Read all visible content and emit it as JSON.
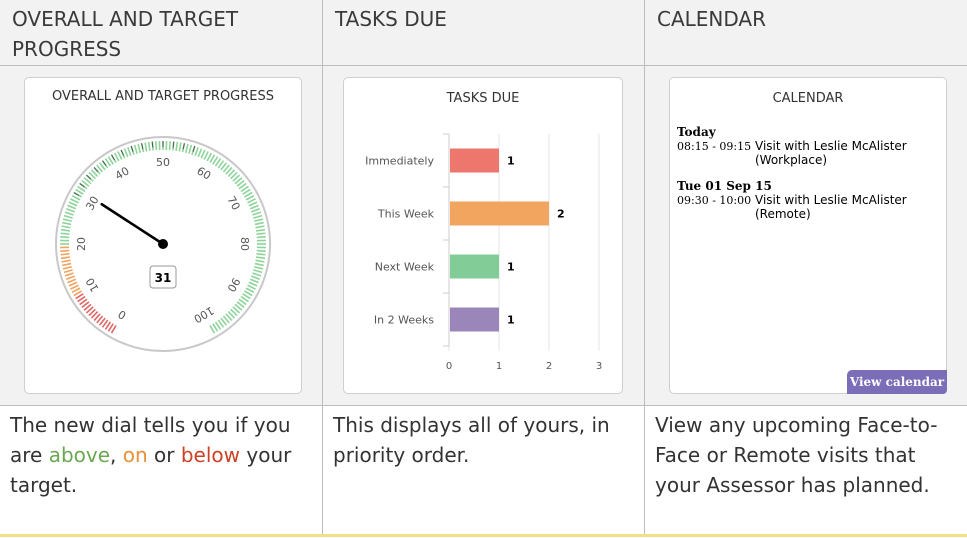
{
  "headers": [
    "OVERALL AND TARGET PROGRESS",
    "TASKS DUE",
    "CALENDAR"
  ],
  "progress_panel": {
    "title": "OVERALL AND TARGET PROGRESS",
    "value": "31",
    "value_num": 31,
    "scale_labels": [
      "0",
      "10",
      "20",
      "30",
      "40",
      "50",
      "60",
      "70",
      "80",
      "90",
      "100"
    ],
    "colors": {
      "red": "#e06666",
      "orange": "#f0a35e",
      "green": "#8ed49a",
      "needle": "#000000"
    }
  },
  "tasks_panel": {
    "title": "TASKS DUE"
  },
  "chart_data": {
    "type": "bar",
    "orientation": "horizontal",
    "title": "TASKS DUE",
    "categories": [
      "Immediately",
      "This Week",
      "Next Week",
      "In 2 Weeks"
    ],
    "values": [
      1,
      2,
      1,
      1
    ],
    "value_labels": [
      "1",
      "2",
      "1",
      "1"
    ],
    "colors": [
      "#ed766d",
      "#f1a55f",
      "#82cc98",
      "#9a86b8"
    ],
    "xlim": [
      0,
      3
    ],
    "x_ticks": [
      "0",
      "1",
      "2",
      "3"
    ],
    "grid": true
  },
  "calendar_panel": {
    "title": "CALENDAR",
    "groups": [
      {
        "day": "Today",
        "time": "08:15 - 09:15",
        "text1": "Visit with Leslie McAlister",
        "text2": "(Workplace)"
      },
      {
        "day": "Tue 01 Sep 15",
        "time": "09:30 - 10:00",
        "text1": "Visit with Leslie McAlister",
        "text2": "(Remote)"
      }
    ],
    "button": "View calendar"
  },
  "descriptions": {
    "col1": {
      "pre": "The new dial tells you if you are ",
      "above": "above",
      "sep1": ", ",
      "on": "on",
      "sep2": " or ",
      "below": "below",
      "post": " your target."
    },
    "col2": "This displays all of yours, in priority order.",
    "col3": "View any upcoming Face-to-Face or Remote visits that your Assessor has planned."
  }
}
